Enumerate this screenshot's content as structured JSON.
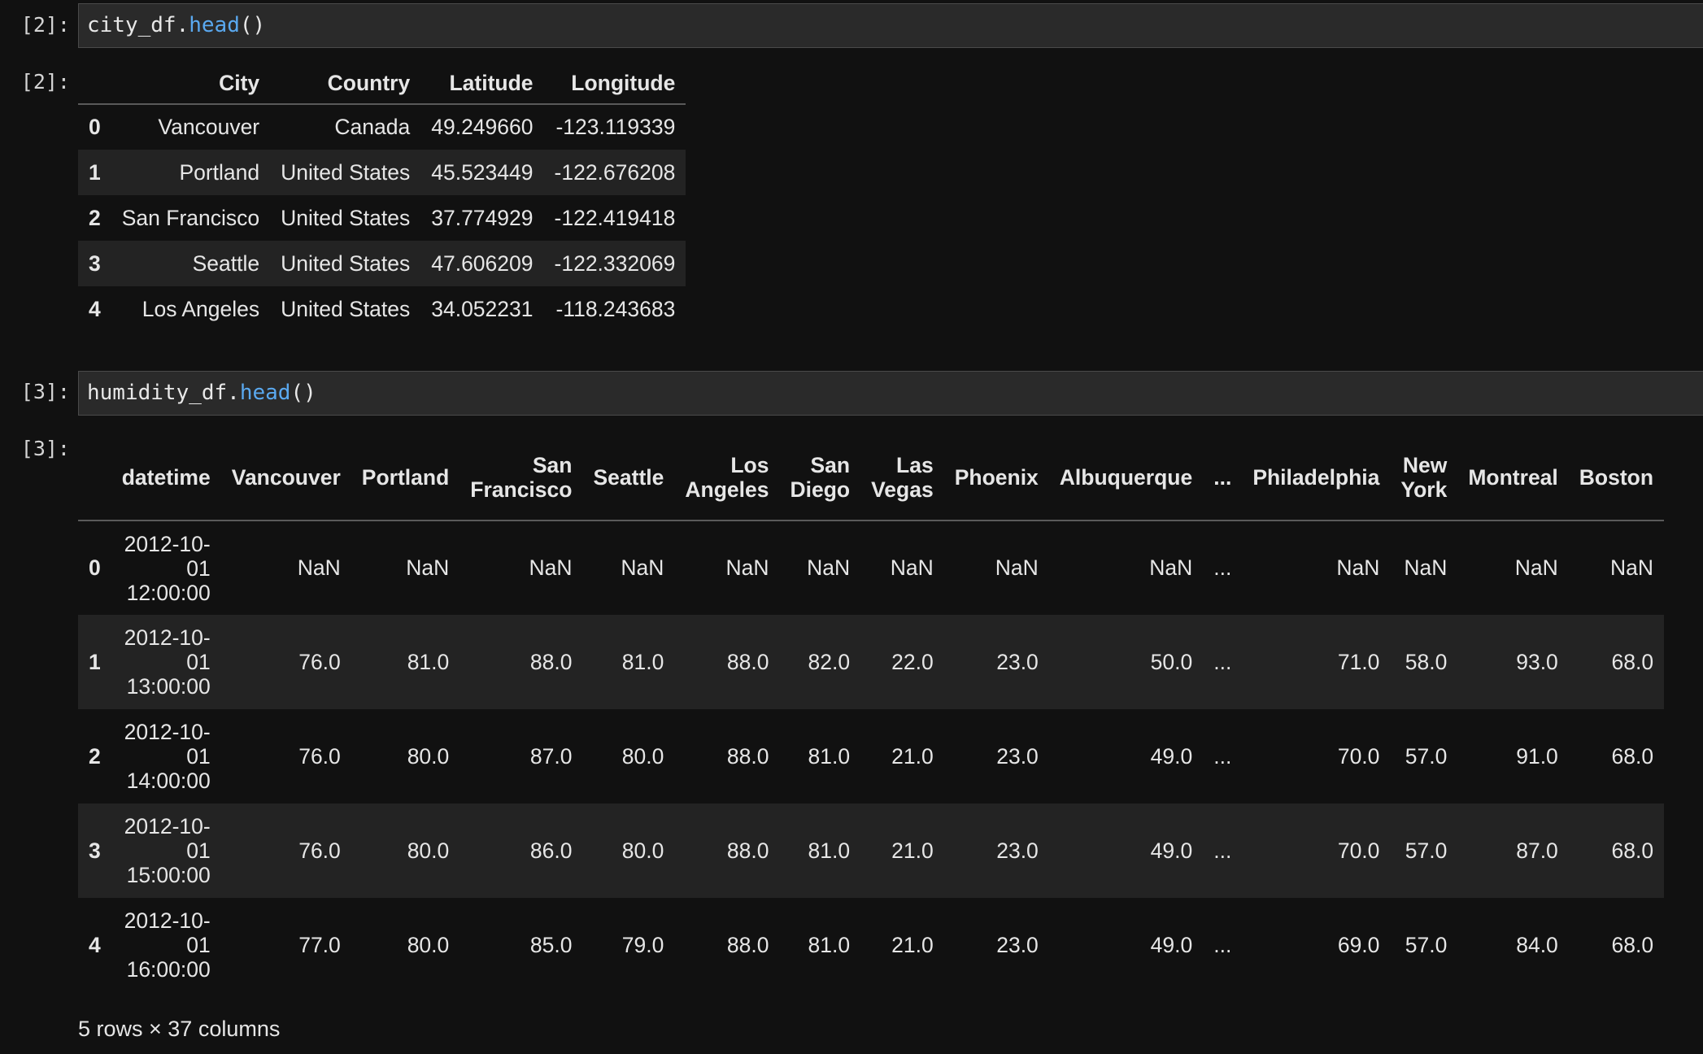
{
  "cells": [
    {
      "prompt_in": "[2]:",
      "prompt_out": "[2]:",
      "code": {
        "object": "city_df.",
        "method": "head",
        "args": "()"
      }
    },
    {
      "prompt_in": "[3]:",
      "prompt_out": "[3]:",
      "code": {
        "object": "humidity_df.",
        "method": "head",
        "args": "()"
      }
    }
  ],
  "city_table": {
    "columns": [
      "City",
      "Country",
      "Latitude",
      "Longitude"
    ],
    "rows": [
      {
        "index": "0",
        "values": [
          "Vancouver",
          "Canada",
          "49.249660",
          "-123.119339"
        ]
      },
      {
        "index": "1",
        "values": [
          "Portland",
          "United States",
          "45.523449",
          "-122.676208"
        ]
      },
      {
        "index": "2",
        "values": [
          "San Francisco",
          "United States",
          "37.774929",
          "-122.419418"
        ]
      },
      {
        "index": "3",
        "values": [
          "Seattle",
          "United States",
          "47.606209",
          "-122.332069"
        ]
      },
      {
        "index": "4",
        "values": [
          "Los Angeles",
          "United States",
          "34.052231",
          "-118.243683"
        ]
      }
    ]
  },
  "humidity_table": {
    "columns": [
      [
        "datetime"
      ],
      [
        "Vancouver"
      ],
      [
        "Portland"
      ],
      [
        "San",
        "Francisco"
      ],
      [
        "Seattle"
      ],
      [
        "Los",
        "Angeles"
      ],
      [
        "San",
        "Diego"
      ],
      [
        "Las",
        "Vegas"
      ],
      [
        "Phoenix"
      ],
      [
        "Albuquerque"
      ],
      [
        "..."
      ],
      [
        "Philadelphia"
      ],
      [
        "New",
        "York"
      ],
      [
        "Montreal"
      ],
      [
        "Boston"
      ]
    ],
    "rows": [
      {
        "index": "0",
        "datetime": [
          "2012-10-",
          "01",
          "12:00:00"
        ],
        "values": [
          "NaN",
          "NaN",
          "NaN",
          "NaN",
          "NaN",
          "NaN",
          "NaN",
          "NaN",
          "NaN",
          "...",
          "NaN",
          "NaN",
          "NaN",
          "NaN"
        ]
      },
      {
        "index": "1",
        "datetime": [
          "2012-10-",
          "01",
          "13:00:00"
        ],
        "values": [
          "76.0",
          "81.0",
          "88.0",
          "81.0",
          "88.0",
          "82.0",
          "22.0",
          "23.0",
          "50.0",
          "...",
          "71.0",
          "58.0",
          "93.0",
          "68.0"
        ]
      },
      {
        "index": "2",
        "datetime": [
          "2012-10-",
          "01",
          "14:00:00"
        ],
        "values": [
          "76.0",
          "80.0",
          "87.0",
          "80.0",
          "88.0",
          "81.0",
          "21.0",
          "23.0",
          "49.0",
          "...",
          "70.0",
          "57.0",
          "91.0",
          "68.0"
        ]
      },
      {
        "index": "3",
        "datetime": [
          "2012-10-",
          "01",
          "15:00:00"
        ],
        "values": [
          "76.0",
          "80.0",
          "86.0",
          "80.0",
          "88.0",
          "81.0",
          "21.0",
          "23.0",
          "49.0",
          "...",
          "70.0",
          "57.0",
          "87.0",
          "68.0"
        ]
      },
      {
        "index": "4",
        "datetime": [
          "2012-10-",
          "01",
          "16:00:00"
        ],
        "values": [
          "77.0",
          "80.0",
          "85.0",
          "79.0",
          "88.0",
          "81.0",
          "21.0",
          "23.0",
          "49.0",
          "...",
          "69.0",
          "57.0",
          "84.0",
          "68.0"
        ]
      }
    ],
    "footer": "5 rows × 37 columns"
  }
}
